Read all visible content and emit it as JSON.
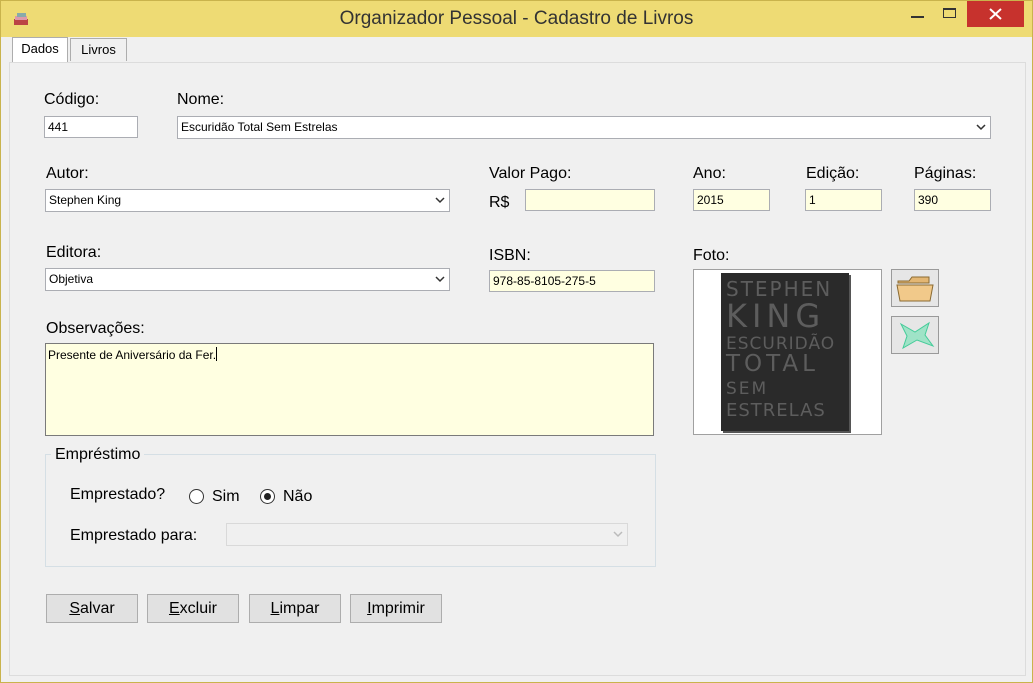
{
  "window": {
    "title": "Organizador Pessoal - Cadastro de Livros"
  },
  "tabs": [
    {
      "label": "Dados",
      "active": true
    },
    {
      "label": "Livros",
      "active": false
    }
  ],
  "form": {
    "codigo": {
      "label": "Código:",
      "value": "441"
    },
    "nome": {
      "label": "Nome:",
      "value": "Escuridão Total Sem Estrelas"
    },
    "autor": {
      "label": "Autor:",
      "value": "Stephen King"
    },
    "valor_pago": {
      "label": "Valor Pago:",
      "prefix": "R$",
      "value": ""
    },
    "ano": {
      "label": "Ano:",
      "value": "2015"
    },
    "edicao": {
      "label": "Edição:",
      "value": "1"
    },
    "paginas": {
      "label": "Páginas:",
      "value": "390"
    },
    "editora": {
      "label": "Editora:",
      "value": "Objetiva"
    },
    "isbn": {
      "label": "ISBN:",
      "value": "978-85-8105-275-5"
    },
    "foto": {
      "label": "Foto:"
    },
    "observacoes": {
      "label": "Observações:",
      "value": "Presente de Aniversário da Fer."
    }
  },
  "book_cover": {
    "lines": [
      "STEPHEN",
      "KING",
      "ESCURIDÃO",
      "TOTAL",
      "SEM",
      "ESTRELAS"
    ]
  },
  "emprestimo": {
    "title": "Empréstimo",
    "question": "Emprestado?",
    "options": [
      {
        "label": "Sim",
        "selected": false
      },
      {
        "label": "Não",
        "selected": true
      }
    ],
    "para_label": "Emprestado para:",
    "para_value": ""
  },
  "buttons": {
    "salvar": {
      "mnemonic": "S",
      "rest": "alvar"
    },
    "excluir": {
      "mnemonic": "E",
      "rest": "xcluir"
    },
    "limpar": {
      "mnemonic": "L",
      "rest": "impar"
    },
    "imprimir": {
      "mnemonic": "I",
      "rest": "mprimir"
    }
  },
  "colors": {
    "titlebar": "#eedb74",
    "close": "#c7322d",
    "field_highlight": "#ffffe1"
  }
}
